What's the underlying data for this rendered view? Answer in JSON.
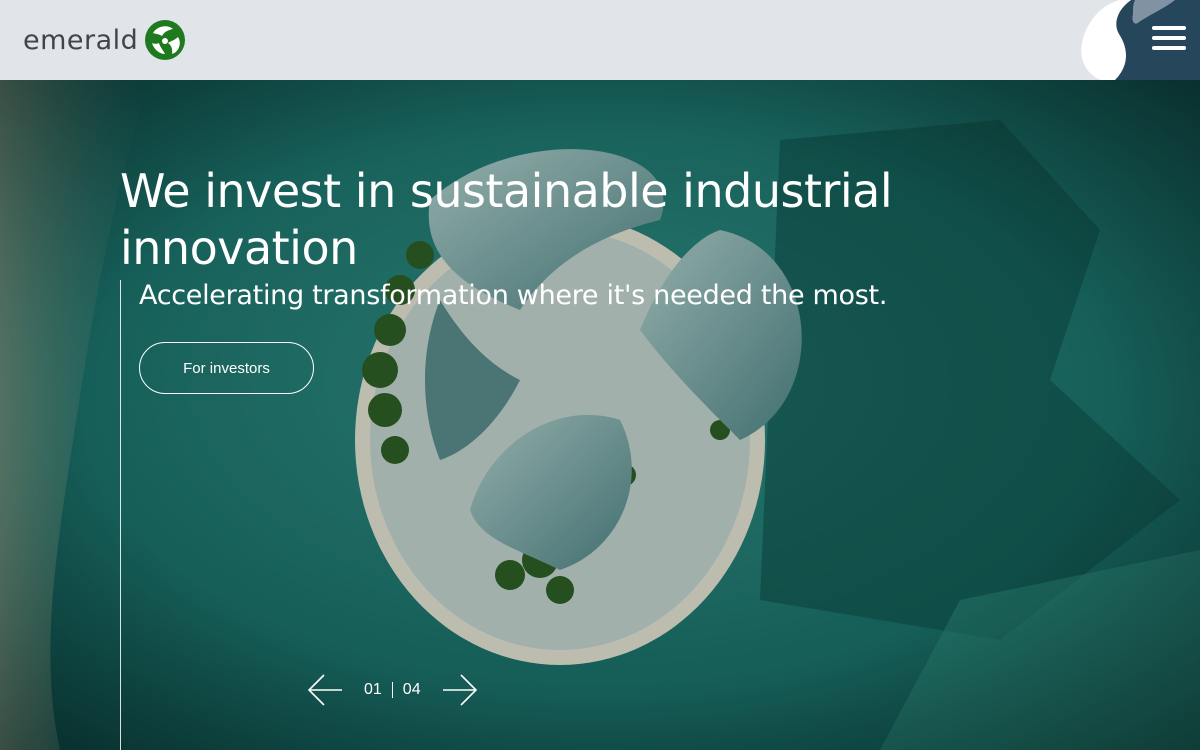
{
  "brand": {
    "name": "emerald",
    "logo_icon": "emerald-leaf-mark",
    "accent": "#1e7d1e"
  },
  "header": {
    "menu_icon": "hamburger-menu-icon",
    "corner_color": "#26465c"
  },
  "hero": {
    "title": "We invest in sustainable industrial innovation",
    "subtitle": "Accelerating transformation where it's needed the most.",
    "cta_label": "For investors",
    "slider": {
      "current": "01",
      "total": "04",
      "prev_icon": "arrow-left-icon",
      "next_icon": "arrow-right-icon"
    },
    "background": "aerial-view-island-architecture"
  }
}
